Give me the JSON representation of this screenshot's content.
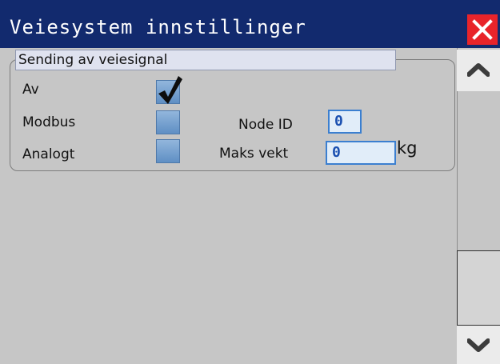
{
  "window": {
    "title": "Veiesystem innstillinger"
  },
  "icons": {
    "close": "close-icon",
    "scroll_up": "chevron-up-icon",
    "scroll_down": "chevron-down-icon",
    "checkmark": "checkmark-icon"
  },
  "colors": {
    "title_bar": "#122a6e",
    "close_button": "#e8242a",
    "background": "#c6c6c6",
    "field_text": "#1a4fb0"
  },
  "group": {
    "header": "Sending av veiesignal",
    "options": [
      {
        "label": "Av",
        "checked": true
      },
      {
        "label": "Modbus",
        "checked": false
      },
      {
        "label": "Analogt",
        "checked": false
      }
    ],
    "node_id": {
      "label": "Node ID",
      "value": "0"
    },
    "max_weight": {
      "label": "Maks vekt",
      "value": "0",
      "unit": "kg"
    }
  },
  "scrollbar": {
    "thumb_position": "bottom"
  }
}
